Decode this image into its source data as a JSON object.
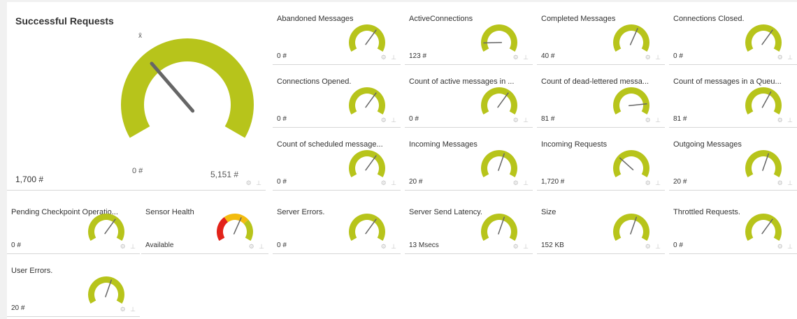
{
  "colors": {
    "gauge": "#b7c41b",
    "needle": "#666666",
    "danger": "#e2231a",
    "warning": "#f3bc0f",
    "tile_border": "#d6d6d6"
  },
  "main_gauge": {
    "title": "Successful Requests",
    "value": "1,700 #",
    "min_label": "0 #",
    "max_label": "5,151 #",
    "marker_glyph": "x̄",
    "needle_fraction": 0.33
  },
  "icons": {
    "settings": "gear-icon",
    "pin": "pin-icon"
  },
  "sensors": [
    {
      "name": "Abandoned Messages",
      "value": "0 #",
      "needle": 0.65
    },
    {
      "name": "ActiveConnections",
      "value": "123 #",
      "needle": 0.12
    },
    {
      "name": "Completed Messages",
      "value": "40 #",
      "needle": 0.6
    },
    {
      "name": "Connections Closed.",
      "value": "0 #",
      "needle": 0.65
    },
    {
      "name": "Connections Opened.",
      "value": "0 #",
      "needle": 0.65
    },
    {
      "name": "Count of active messages in ...",
      "value": "0 #",
      "needle": 0.65
    },
    {
      "name": "Count of dead-lettered messa...",
      "value": "81 #",
      "needle": 0.85
    },
    {
      "name": "Count of messages in a Queu...",
      "value": "81 #",
      "needle": 0.62
    },
    {
      "name": "Count of scheduled message...",
      "value": "0 #",
      "needle": 0.65
    },
    {
      "name": "Incoming Messages",
      "value": "20 #",
      "needle": 0.58
    },
    {
      "name": "Incoming Requests",
      "value": "1,720 #",
      "needle": 0.3
    },
    {
      "name": "Outgoing Messages",
      "value": "20 #",
      "needle": 0.58
    },
    {
      "name": "Pending Checkpoint Operatio...",
      "value": "0 #",
      "needle": 0.65
    },
    {
      "name": "Sensor Health",
      "value": "Available",
      "needle": 0.6,
      "health": true
    },
    {
      "name": "Server Errors.",
      "value": "0 #",
      "needle": 0.65
    },
    {
      "name": "Server Send Latency.",
      "value": "13 Msecs",
      "needle": 0.58
    },
    {
      "name": "Size",
      "value": "152 KB",
      "needle": 0.58
    },
    {
      "name": "Throttled Requests.",
      "value": "0 #",
      "needle": 0.65
    },
    {
      "name": "User Errors.",
      "value": "20 #",
      "needle": 0.58
    }
  ]
}
